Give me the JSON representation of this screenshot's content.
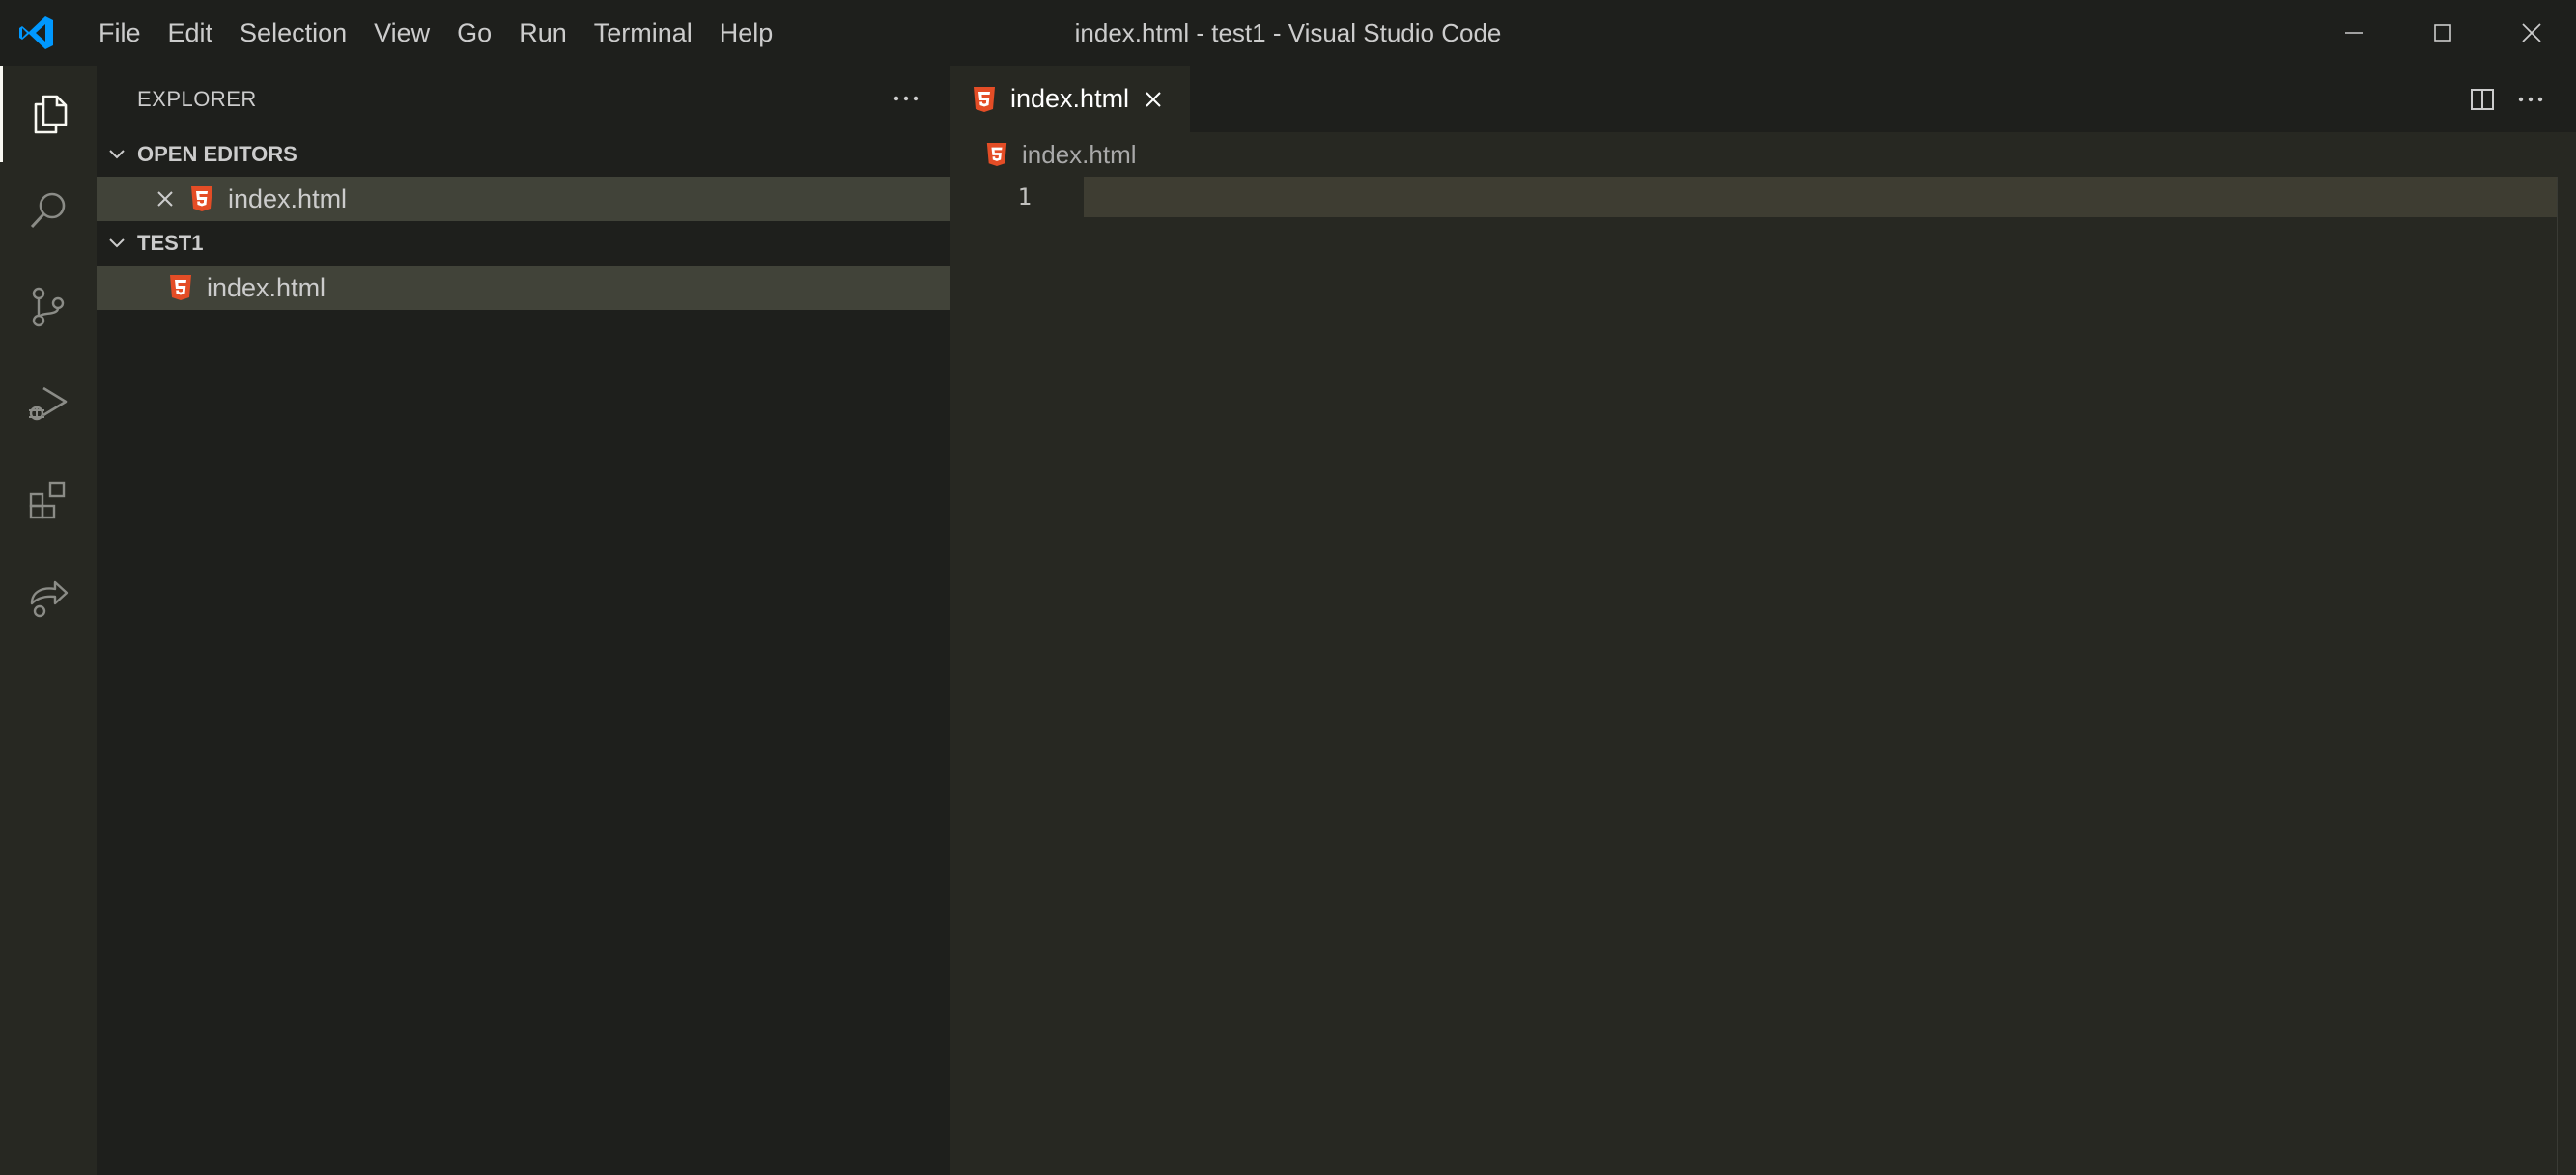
{
  "app": {
    "window_title": "index.html - test1 - Visual Studio Code",
    "logo_icon": "vscode-logo-icon",
    "accent": "#0098ff"
  },
  "menubar": {
    "items": [
      "File",
      "Edit",
      "Selection",
      "View",
      "Go",
      "Run",
      "Terminal",
      "Help"
    ]
  },
  "window_controls": {
    "icons": [
      "minimize-icon",
      "maximize-icon",
      "close-icon"
    ]
  },
  "activitybar": {
    "items": [
      {
        "icon": "explorer-icon",
        "active": true
      },
      {
        "icon": "search-icon",
        "active": false
      },
      {
        "icon": "source-control-icon",
        "active": false
      },
      {
        "icon": "run-debug-icon",
        "active": false
      },
      {
        "icon": "extensions-icon",
        "active": false
      },
      {
        "icon": "live-share-icon",
        "active": false
      }
    ]
  },
  "sidebar": {
    "title": "EXPLORER",
    "more_icon": "ellipsis-icon",
    "open_editors": {
      "title": "OPEN EDITORS",
      "files": [
        {
          "name": "index.html",
          "icon": "html5-icon"
        }
      ]
    },
    "folder": {
      "title": "TEST1",
      "files": [
        {
          "name": "index.html",
          "icon": "html5-icon"
        }
      ]
    }
  },
  "editor": {
    "tab": {
      "label": "index.html",
      "icon": "html5-icon",
      "close_icon": "close-icon"
    },
    "actions": [
      "split-editor-icon",
      "ellipsis-icon"
    ],
    "breadcrumb": {
      "label": "index.html",
      "icon": "html5-icon"
    },
    "lines": [
      {
        "number": "1",
        "text": ""
      }
    ]
  },
  "colors": {
    "html_icon": "#e44d26",
    "selection_bg": "#414339",
    "current_line": "#3e3d32",
    "editor_bg": "#272822",
    "sidebar_bg": "#1e1f1c"
  }
}
